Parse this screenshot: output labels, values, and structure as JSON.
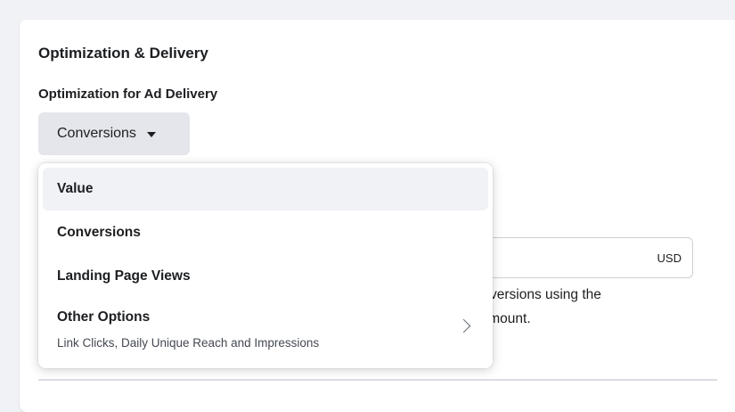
{
  "section": {
    "title": "Optimization & Delivery"
  },
  "field": {
    "label": "Optimization for Ad Delivery"
  },
  "dropdown": {
    "selected": "Conversions",
    "options": [
      {
        "label": "Value"
      },
      {
        "label": "Conversions"
      },
      {
        "label": "Landing Page Views"
      },
      {
        "label": "Other Options",
        "description": "Link Clicks, Daily Unique Reach and Impressions"
      }
    ]
  },
  "background": {
    "currency": "USD",
    "text_line1": "ost conversions using the",
    "text_line2": "er an amount."
  }
}
